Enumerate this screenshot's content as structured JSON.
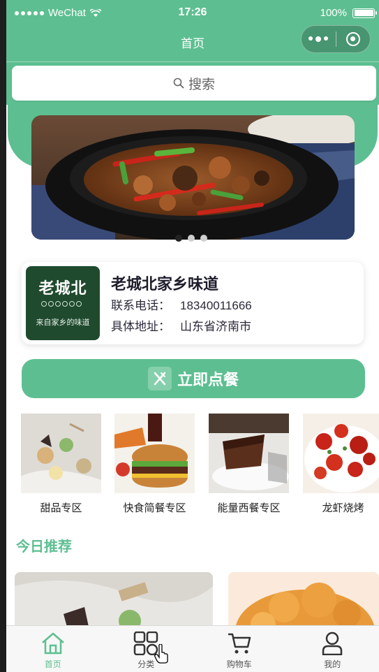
{
  "status_bar": {
    "carrier": "WeChat",
    "time": "17:26",
    "battery": "100%"
  },
  "nav": {
    "title": "首页"
  },
  "search": {
    "placeholder": "搜索"
  },
  "banner": {
    "dot_count": 3,
    "active_index": 0
  },
  "shop": {
    "logo_text": "老城北",
    "logo_sub": "来自家乡的味道",
    "name": "老城北家乡味道",
    "phone_label": "联系电话：",
    "phone": "18340011666",
    "address_label": "具体地址：",
    "address": "山东省济南市"
  },
  "order_button": {
    "label": "立即点餐"
  },
  "categories": [
    {
      "label": "甜品专区"
    },
    {
      "label": "快食简餐专区"
    },
    {
      "label": "能量西餐专区"
    },
    {
      "label": "龙虾烧烤"
    }
  ],
  "today": {
    "title": "今日推荐"
  },
  "tabbar": [
    {
      "label": "首页",
      "icon": "home-icon",
      "active": true
    },
    {
      "label": "分类",
      "icon": "category-icon",
      "active": false
    },
    {
      "label": "购物车",
      "icon": "cart-icon",
      "active": false
    },
    {
      "label": "我的",
      "icon": "user-icon",
      "active": false
    }
  ],
  "colors": {
    "primary": "#5dbf91",
    "text_dark": "#1d1d2b"
  }
}
